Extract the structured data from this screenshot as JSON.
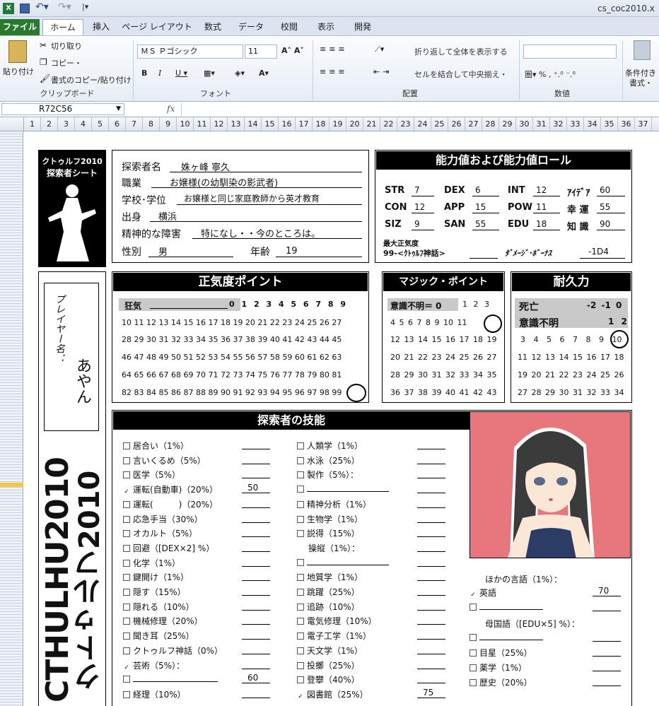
{
  "window": {
    "title": "cs_coc2010.x"
  },
  "tabs": [
    "ファイル",
    "ホーム",
    "挿入",
    "ページ レイアウト",
    "数式",
    "データ",
    "校閲",
    "表示",
    "開発"
  ],
  "ribbon": {
    "clipboard": {
      "paste": "貼り付け",
      "cut": "切り取り",
      "copy": "コピー・",
      "format_copy": "書式のコピー/貼り付け",
      "label": "クリップボード"
    },
    "font": {
      "name": "ＭＳ Ｐゴシック",
      "size": "11",
      "label": "フォント"
    },
    "alignment": {
      "wrap": "折り返して全体を表示する",
      "merge": "セルを結合して中央揃え・",
      "label": "配置"
    },
    "number": {
      "label": "数値"
    },
    "styles": {
      "cond": "条件付き",
      "cond2": "書式・"
    }
  },
  "formula": {
    "namebox": "R72C56",
    "fx": "fx",
    "value": ""
  },
  "columns": [
    "1",
    "2",
    "3",
    "4",
    "5",
    "6",
    "7",
    "8",
    "9",
    "10",
    "11",
    "12",
    "13",
    "14",
    "15",
    "16",
    "17",
    "18",
    "19",
    "20",
    "21",
    "22",
    "23",
    "24",
    "25",
    "26",
    "27",
    "28",
    "29",
    "30",
    "31",
    "32",
    "33",
    "34",
    "35",
    "36",
    "37"
  ],
  "sheet": {
    "logo": {
      "line1": "クトゥルフ2010",
      "line2": "探索者シート"
    },
    "side_title": {
      "en": "CTHULHU2010",
      "ja": "クトゥルフ2010"
    },
    "player": {
      "label": "プレイヤー名：",
      "name": "あやん"
    },
    "profile": {
      "name_label": "探索者名",
      "name": "姝ヶ峰 寧久",
      "job_label": "職業",
      "job": "お嬢様(の幼馴染の影武者)",
      "school_label": "学校･学位",
      "school": "お嬢様と同じ家庭教師から英才教育",
      "origin_label": "出身",
      "origin": "横浜",
      "mental_label": "精神的な障害",
      "mental": "特になし・・今のところは。",
      "sex_label": "性別",
      "sex": "男",
      "age_label": "年齢",
      "age": "19"
    },
    "abilities": {
      "header": "能力値および能力値ロール",
      "stats": [
        {
          "k": "STR",
          "v": "7"
        },
        {
          "k": "DEX",
          "v": "6"
        },
        {
          "k": "INT",
          "v": "12"
        },
        {
          "k": "ｱｲﾃﾞｱ",
          "v": "60"
        },
        {
          "k": "CON",
          "v": "12"
        },
        {
          "k": "APP",
          "v": "15"
        },
        {
          "k": "POW",
          "v": "11"
        },
        {
          "k": "幸 運",
          "v": "55"
        },
        {
          "k": "SIZ",
          "v": "9"
        },
        {
          "k": "SAN",
          "v": "55"
        },
        {
          "k": "EDU",
          "v": "18"
        },
        {
          "k": "知 識",
          "v": "90"
        }
      ],
      "max_san_label": "最大正気度",
      "max_san": "99-<ｸﾄｩﾙﾌ神話>",
      "damage_label": "ﾀﾞﾒｰｼﾞ･ﾎﾞｰﾅｽ",
      "damage": "-1D4"
    },
    "sanity": {
      "header": "正気度ポイント",
      "insane": "狂気",
      "rows": [
        "0 1 2 3 4 5 6 7 8 9",
        "10 11 12 13 14 15 16 17 18 19 20 21 22 23 24 25 26 27",
        "28 29 30 31 32 33 34 35 36 37 38 39 40 41 42 43 44 45",
        "46 47 48 49 50 51 52 53 54 55 56 57 58 59 60 61 62 63",
        "64 65 66 67 68 69 70 71 72 73 74 75 76 77 78 79 80 81",
        "82 83 84 85 86 87 88 89 90 91 92 93 94 95 96 97 98 99"
      ],
      "current": "99"
    },
    "magic": {
      "header": "マジック・ポイント",
      "unconscious": "意識不明＝ 0",
      "rows": [
        "1 2 3",
        "4 5 6 7 8 9 10 11",
        "12 13 14 15 16 17 18 19",
        "20 21 22 23 24 25 26 27",
        "28 29 30 31 32 33 34 35",
        "36 37 38 39 40 41 42 43"
      ],
      "current": "11"
    },
    "hp": {
      "header": "耐久力",
      "dead": "死亡",
      "dead_vals": "-2 -1 0",
      "unconscious": "意識不明",
      "unc_vals": "1 2",
      "rows": [
        "3 4 5 6 7 8 9 10",
        "11 12 13 14 15 16 17 18",
        "19 20 21 22 23 24 25 26",
        "27 28 29 30 31 32 33 34"
      ],
      "current": "10"
    },
    "skills": {
      "header": "探索者の技能",
      "col1": [
        {
          "n": "居合い（1%）",
          "v": "",
          "c": false
        },
        {
          "n": "言いくるめ（5%）",
          "v": "",
          "c": false
        },
        {
          "n": "医学（5%）",
          "v": "",
          "c": false
        },
        {
          "n": "運転(自動車)（20%）",
          "v": "50",
          "c": true
        },
        {
          "n": "運転(　　　)（20%）",
          "v": "",
          "c": false
        },
        {
          "n": "応急手当（30%）",
          "v": "",
          "c": false
        },
        {
          "n": "オカルト（5%）",
          "v": "",
          "c": false
        },
        {
          "n": "回避（[DEX×2] %）",
          "v": "",
          "c": false
        },
        {
          "n": "化学（1%）",
          "v": "",
          "c": false
        },
        {
          "n": "鍵開け（1%）",
          "v": "",
          "c": false
        },
        {
          "n": "隠す（15%）",
          "v": "",
          "c": false
        },
        {
          "n": "隠れる（10%）",
          "v": "",
          "c": false
        },
        {
          "n": "機械修理（20%）",
          "v": "",
          "c": false
        },
        {
          "n": "聞き耳（25%）",
          "v": "",
          "c": false
        },
        {
          "n": "クトゥルフ神話（0%）",
          "v": "",
          "c": false
        },
        {
          "n": "芸術（5%）：",
          "v": "",
          "c": true
        },
        {
          "n": "",
          "v": "60",
          "c": false
        },
        {
          "n": "経理（10%）",
          "v": "",
          "c": false
        }
      ],
      "col2": [
        {
          "n": "人類学（1%）",
          "v": "",
          "c": false
        },
        {
          "n": "水泳（25%）",
          "v": "",
          "c": false
        },
        {
          "n": "製作（5%）：",
          "v": "",
          "c": false
        },
        {
          "n": "",
          "v": "",
          "c": false
        },
        {
          "n": "精神分析（1%）",
          "v": "",
          "c": false
        },
        {
          "n": "生物学（1%）",
          "v": "",
          "c": false
        },
        {
          "n": "説得（15%）",
          "v": "",
          "c": false
        },
        {
          "n": "操縦（1%）：",
          "v": "",
          "c": null
        },
        {
          "n": "",
          "v": "",
          "c": false
        },
        {
          "n": "地質学（1%）",
          "v": "",
          "c": false
        },
        {
          "n": "跳躍（25%）",
          "v": "",
          "c": false
        },
        {
          "n": "追跡（10%）",
          "v": "",
          "c": false
        },
        {
          "n": "電気修理（10%）",
          "v": "",
          "c": false
        },
        {
          "n": "電子工学（1%）",
          "v": "",
          "c": false
        },
        {
          "n": "天文学（1%）",
          "v": "",
          "c": false
        },
        {
          "n": "投擲（25%）",
          "v": "",
          "c": false
        },
        {
          "n": "登攀（40%）",
          "v": "",
          "c": false
        },
        {
          "n": "図書館（25%）",
          "v": "75",
          "c": true
        }
      ],
      "col3_title": "ほかの言語（1%）：",
      "col3": [
        {
          "n": "英語",
          "v": "70",
          "c": true
        },
        {
          "n": "",
          "v": "",
          "c": false
        }
      ],
      "native_title": "母国語（[EDU×5] %）：",
      "col3b": [
        {
          "n": "",
          "v": "",
          "c": false
        },
        {
          "n": "目星（25%）",
          "v": "",
          "c": false
        },
        {
          "n": "薬学（1%）",
          "v": "",
          "c": false
        },
        {
          "n": "歴史（20%）",
          "v": "",
          "c": false
        }
      ]
    },
    "colors": {
      "ribbon_active": "#ffffff",
      "file_tab": "#2a7a2e",
      "portrait_bg": "#e8777d",
      "hair": "#3a3a3a"
    }
  }
}
